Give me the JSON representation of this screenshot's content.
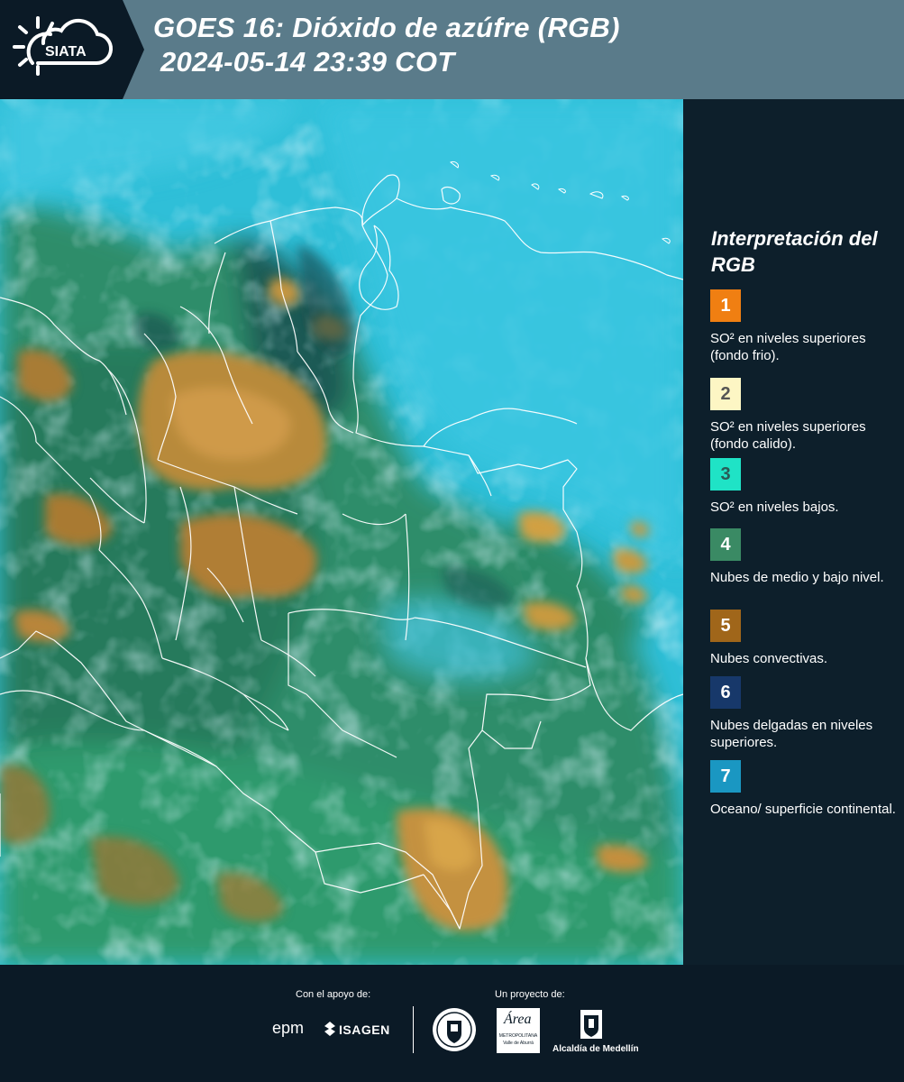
{
  "header": {
    "logo_text": "SIATA",
    "title_line1": "GOES 16: Dióxido de azúfre (RGB)",
    "title_line2": "2024-05-14 23:39 COT"
  },
  "legend": {
    "title": "Interpretación del RGB",
    "items": [
      {
        "number": "1",
        "label": "SO² en niveles superiores (fondo frio).",
        "color": "#f07f12",
        "text_color": "#ffffff"
      },
      {
        "number": "2",
        "label": "SO² en niveles superiores (fondo calido).",
        "color": "#fdf6c4",
        "text_color": "#555555"
      },
      {
        "number": "3",
        "label": "SO² en niveles bajos.",
        "color": "#1fe3c6",
        "text_color": "#2a5a55"
      },
      {
        "number": "4",
        "label": "Nubes de medio y bajo nivel.",
        "color": "#3a8a64",
        "text_color": "#ffffff"
      },
      {
        "number": "5",
        "label": "Nubes convectivas.",
        "color": "#a0661a",
        "text_color": "#ffffff"
      },
      {
        "number": "6",
        "label": "Nubes delgadas en niveles superiores.",
        "color": "#17386a",
        "text_color": "#ffffff"
      },
      {
        "number": "7",
        "label": "Oceano/ superficie continental.",
        "color": "#1a97c2",
        "text_color": "#ffffff"
      }
    ]
  },
  "footer": {
    "support_label": "Con el apoyo de:",
    "project_label": "Un proyecto de:",
    "sponsors": {
      "epm": "epm",
      "isagen": "ISAGEN",
      "area": "Área",
      "area_sub": "METROPOLITANA",
      "area_sub2": "Valle de Aburrá",
      "alcaldia": "Alcaldía de Medellín"
    }
  }
}
